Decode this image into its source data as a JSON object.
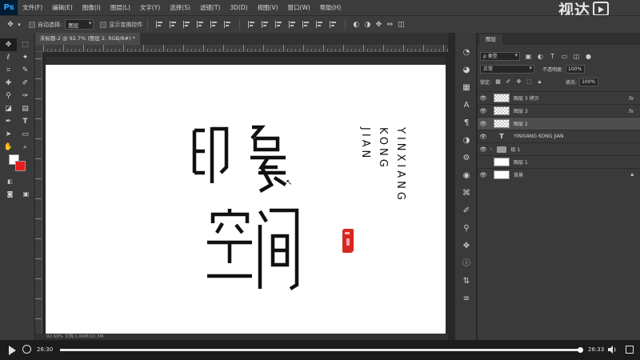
{
  "app": {
    "logo": "Ps",
    "menu": [
      "文件(F)",
      "编辑(E)",
      "图像(I)",
      "图层(L)",
      "文字(Y)",
      "选择(S)",
      "滤镜(T)",
      "3D(D)",
      "视图(V)",
      "窗口(W)",
      "帮助(H)"
    ],
    "watermark": "视达"
  },
  "options_bar": {
    "auto_select_label": "自动选择:",
    "auto_select_value": "图层",
    "show_transform_label": "显示变换控件"
  },
  "document": {
    "tab_title": "未标题-2 @ 92.7% (图层 2, RGB/8#) *",
    "status": "92.68%   文档:1.66M/10.3M"
  },
  "artwork": {
    "chars_top": "印象",
    "chars_bottom": "空间",
    "english_lines": [
      "YINXIANG",
      "KONG",
      "JIAN"
    ],
    "ink_color": "#111111",
    "seal_color": "#d7261e"
  },
  "layers_panel": {
    "tab": "图层",
    "filter_label": "ρ 类型",
    "blend_mode": "正常",
    "opacity_label": "不透明度:",
    "opacity_value": "100%",
    "lock_label": "锁定:",
    "fill_label": "填充:",
    "fill_value": "100%",
    "layers": [
      {
        "name": "图层 3 拷贝",
        "kind": "pattern",
        "fx": "fx"
      },
      {
        "name": "图层 3",
        "kind": "pattern",
        "fx": "fx"
      },
      {
        "name": "图层 2",
        "kind": "pattern",
        "fx": ""
      },
      {
        "name": "YINXIANG KONG JIAN",
        "kind": "text",
        "fx": ""
      },
      {
        "name": "组 1",
        "kind": "group",
        "fx": ""
      },
      {
        "name": "图层 1",
        "kind": "white",
        "fx": ""
      },
      {
        "name": "背景",
        "kind": "white",
        "fx": ""
      }
    ]
  },
  "video": {
    "current_time": "26:30",
    "total_time": "26:33",
    "progress": 0.998
  }
}
